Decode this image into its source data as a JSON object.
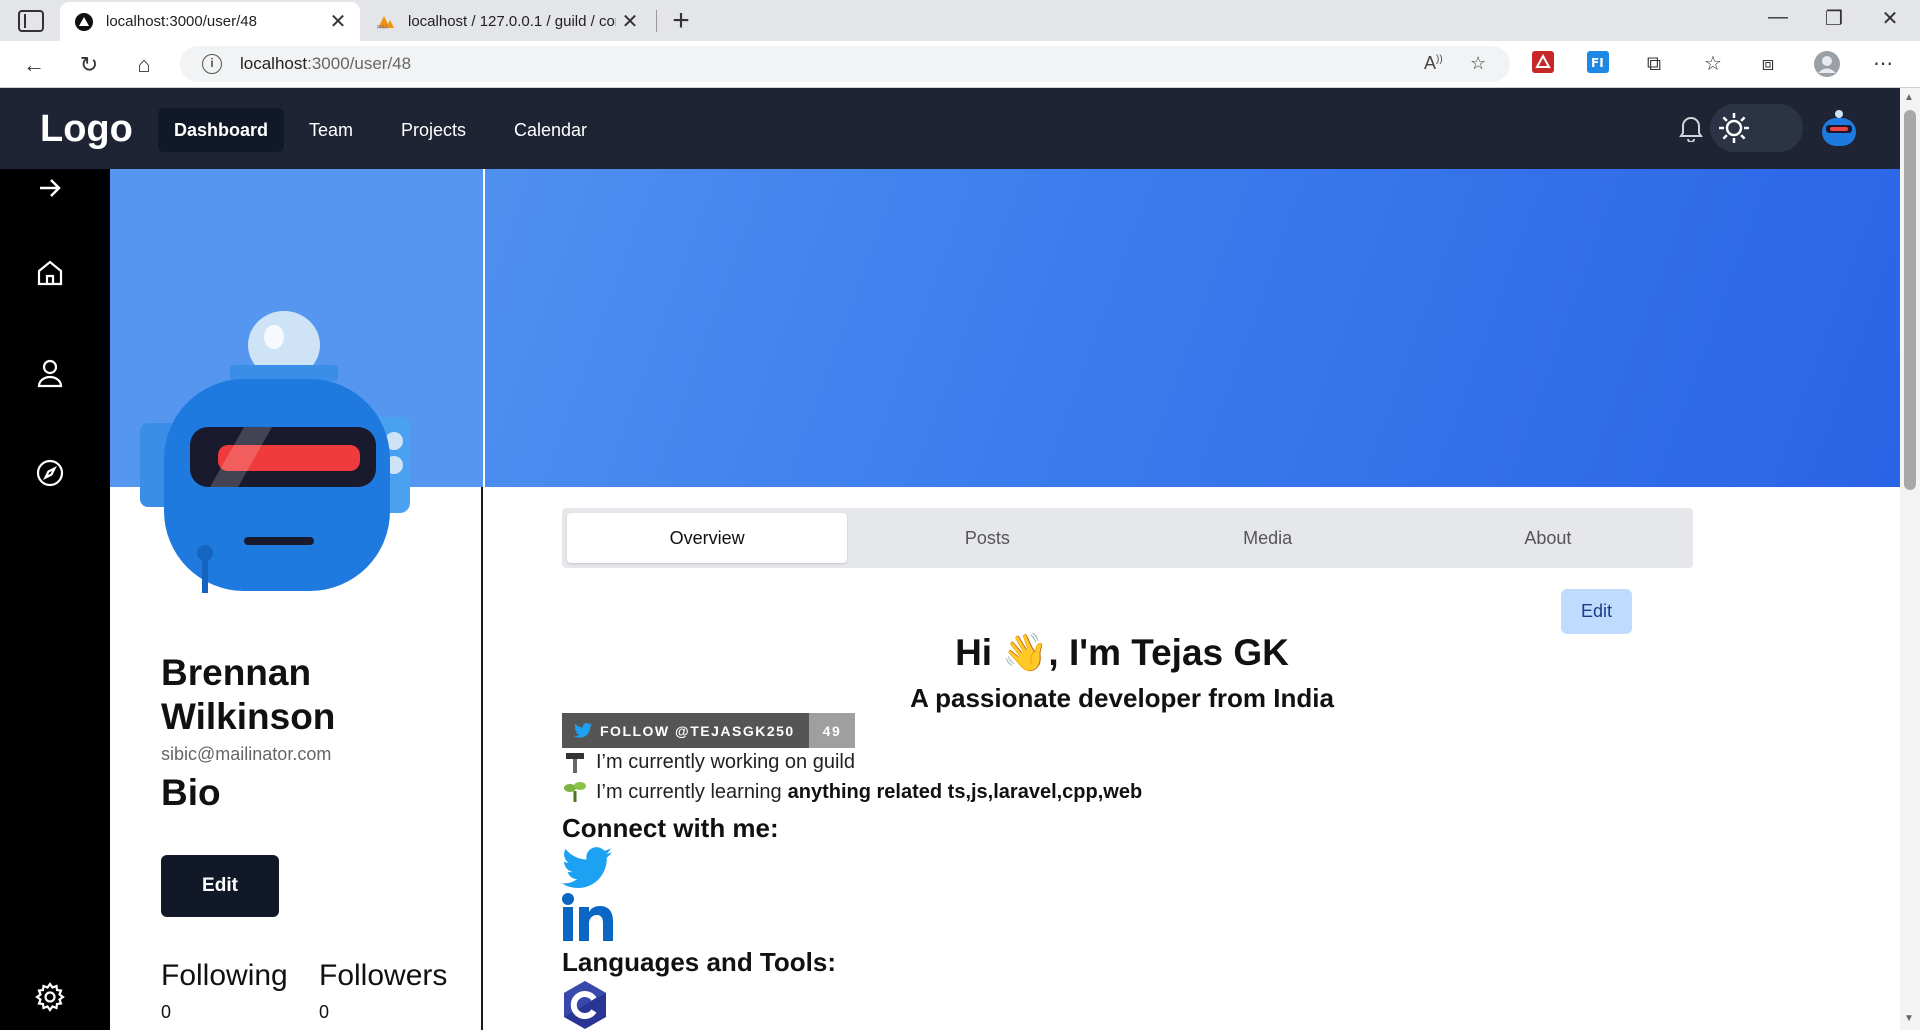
{
  "browser": {
    "tabs": [
      {
        "title": "localhost:3000/user/48",
        "active": true
      },
      {
        "title": "localhost / 127.0.0.1 / guild / con",
        "active": false
      }
    ],
    "url_host": "localhost",
    "url_path": ":3000/user/48"
  },
  "header": {
    "logo": "Logo",
    "nav": [
      "Dashboard",
      "Team",
      "Projects",
      "Calendar"
    ],
    "active_nav": "Dashboard"
  },
  "profile": {
    "name": "Brennan Wilkinson",
    "email": "sibic@mailinator.com",
    "bio_label": "Bio",
    "edit_label": "Edit",
    "following_label": "Following",
    "following_count": "0",
    "followers_label": "Followers",
    "followers_count": "0"
  },
  "main": {
    "tabs": [
      "Overview",
      "Posts",
      "Media",
      "About"
    ],
    "active_tab": "Overview",
    "edit_label": "Edit",
    "readme": {
      "title": "Hi 👋, I'm Tejas GK",
      "subtitle": "A passionate developer from India",
      "badge_left": "FOLLOW @TEJASGK250",
      "badge_count": "49",
      "working_text": "I’m currently working on guild",
      "learning_text": "I’m currently learning",
      "learning_bold": "anything related ts,js,laravel,cpp,web",
      "connect_heading": "Connect with me:",
      "tools_heading": "Languages and Tools:"
    }
  },
  "colors": {
    "header_bg": "#1e2433",
    "sidebar_bg": "#000000",
    "profile_cover": "#5597f0",
    "main_cover": "#3b7ded",
    "edit_light_bg": "#bfdbfe",
    "twitter_blue": "#1da1f2",
    "linkedin_blue": "#0a66c2"
  }
}
